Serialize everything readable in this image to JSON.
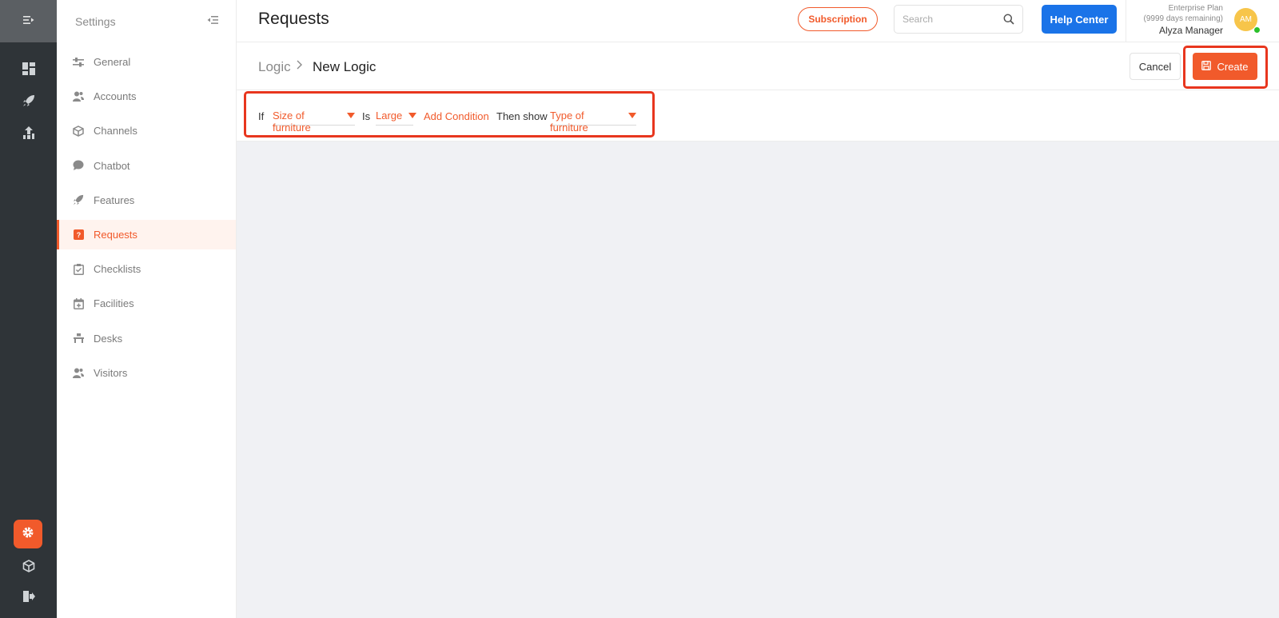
{
  "rail": {
    "icons": [
      "menu-collapse-icon",
      "dashboard-icon",
      "rocket-icon",
      "analytics-icon",
      "settings-gear-icon",
      "box-icon",
      "logout-icon"
    ]
  },
  "sidebar": {
    "title": "Settings",
    "items": [
      {
        "label": "General",
        "icon": "sliders-icon"
      },
      {
        "label": "Accounts",
        "icon": "users-icon"
      },
      {
        "label": "Channels",
        "icon": "cube-icon"
      },
      {
        "label": "Chatbot",
        "icon": "chat-bubble-icon"
      },
      {
        "label": "Features",
        "icon": "rocket-icon"
      },
      {
        "label": "Requests",
        "icon": "question-icon",
        "active": true
      },
      {
        "label": "Checklists",
        "icon": "checklist-icon"
      },
      {
        "label": "Facilities",
        "icon": "calendar-plus-icon"
      },
      {
        "label": "Desks",
        "icon": "desk-icon"
      },
      {
        "label": "Visitors",
        "icon": "visitor-icon"
      }
    ]
  },
  "header": {
    "title": "Requests",
    "subscription_label": "Subscription",
    "search_placeholder": "Search",
    "help_label": "Help Center",
    "plan_line1": "Enterprise Plan",
    "plan_line2": "(9999 days remaining)",
    "user_name": "Alyza Manager",
    "avatar_initials": "AM"
  },
  "breadcrumb": {
    "root": "Logic",
    "current": "New Logic"
  },
  "actions": {
    "cancel_label": "Cancel",
    "create_label": "Create"
  },
  "logic": {
    "if_label": "If",
    "field_value": "Size of furniture",
    "is_label": "Is",
    "condition_value": "Large",
    "add_condition_label": "Add Condition",
    "then_label": "Then show",
    "target_value": "Type of furniture"
  },
  "colors": {
    "accent": "#f15a2b",
    "primary_blue": "#1a73e8",
    "rail_bg": "#2f3438",
    "highlight_outline": "#e8361e",
    "content_bg": "#f0f1f4"
  }
}
